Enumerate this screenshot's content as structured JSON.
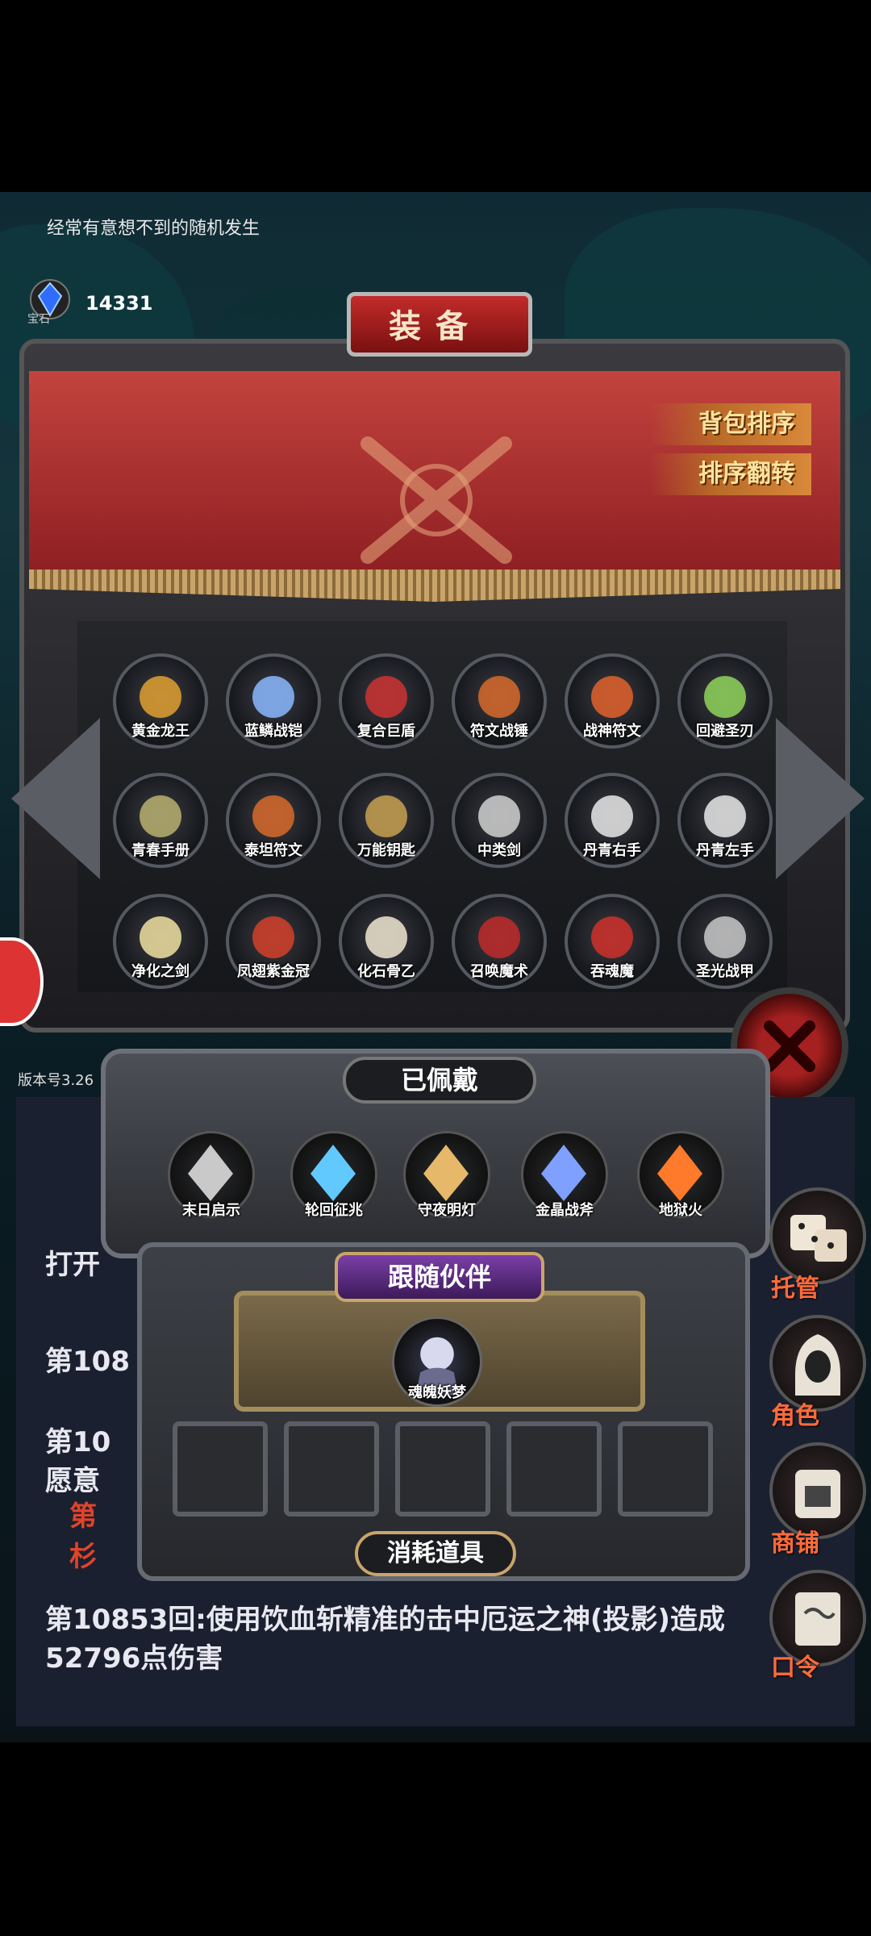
{
  "hint": "经常有意想不到的随机发生",
  "currency": {
    "label": "宝石",
    "amount": "14331"
  },
  "equipment": {
    "title": "装备",
    "sort_bag": "背包排序",
    "sort_reverse": "排序翻转",
    "items": [
      {
        "name": "黄金龙王",
        "icon": "golden-dragon-icon"
      },
      {
        "name": "蓝鳞战铠",
        "icon": "blue-armor-icon"
      },
      {
        "name": "复合巨盾",
        "icon": "shield-icon"
      },
      {
        "name": "符文战锤",
        "icon": "hammer-icon"
      },
      {
        "name": "战神符文",
        "icon": "rune-icon"
      },
      {
        "name": "回避圣刃",
        "icon": "blade-icon"
      },
      {
        "name": "青春手册",
        "icon": "book-icon"
      },
      {
        "name": "泰坦符文",
        "icon": "rune-icon"
      },
      {
        "name": "万能钥匙",
        "icon": "key-icon"
      },
      {
        "name": "中类剑",
        "icon": "sword-icon"
      },
      {
        "name": "丹青右手",
        "icon": "glove-icon"
      },
      {
        "name": "丹青左手",
        "icon": "glove-icon"
      },
      {
        "name": "净化之剑",
        "icon": "sword-icon"
      },
      {
        "name": "凤翅紫金冠",
        "icon": "crown-icon"
      },
      {
        "name": "化石骨乙",
        "icon": "bone-icon"
      },
      {
        "name": "召唤魔术",
        "icon": "pentagram-icon"
      },
      {
        "name": "吞魂魔",
        "icon": "demon-icon"
      },
      {
        "name": "圣光战甲",
        "icon": "knight-armor-icon"
      }
    ]
  },
  "version": "版本号3.26",
  "worn": {
    "title": "已佩戴",
    "items": [
      {
        "name": "末日启示",
        "icon": "mace-icon"
      },
      {
        "name": "轮回征兆",
        "icon": "crystal-icon"
      },
      {
        "name": "守夜明灯",
        "icon": "lantern-icon"
      },
      {
        "name": "金晶战斧",
        "icon": "axe-icon"
      },
      {
        "name": "地狱火",
        "icon": "fireball-icon"
      }
    ]
  },
  "partner": {
    "title": "跟随伙伴",
    "name": "魂魄妖梦"
  },
  "consume": {
    "title": "消耗道具"
  },
  "side": {
    "auto": "托管",
    "role": "角色",
    "shop": "商铺",
    "code": "口令"
  },
  "log": {
    "line1": "打开",
    "line2": "第108",
    "line3": "第10",
    "line4": "愿意",
    "line5a": "第",
    "line5b": "杉",
    "line6": "第10853回:使用饮血斩精准的击中厄运之神(投影)造成",
    "line7": "52796点伤害"
  },
  "colors": {
    "accent": "#c3433e",
    "gold": "#caa56a",
    "sideLabel": "#ff6a3a"
  }
}
